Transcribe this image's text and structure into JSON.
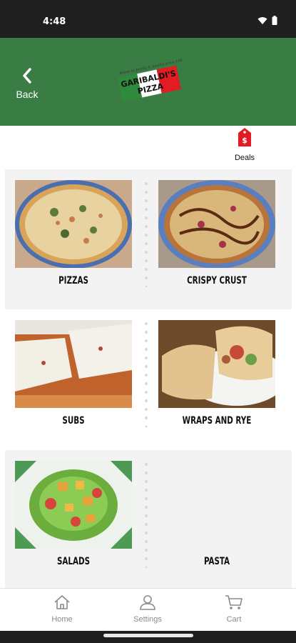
{
  "status_bar": {
    "time": "4:48",
    "icons": [
      "wifi-icon",
      "battery-icon"
    ]
  },
  "header": {
    "back_label": "Back",
    "logo": {
      "brand": "GARIBALDI'S PIZZA",
      "tagline": "Home to family & quality since 1987"
    },
    "background": "#3a7d44"
  },
  "deals": {
    "label": "Deals",
    "icon": "price-tag-icon",
    "color": "#e31b23"
  },
  "categories": [
    {
      "label": "PIZZAS"
    },
    {
      "label": "CRISPY CRUST"
    },
    {
      "label": "SUBS"
    },
    {
      "label": "WRAPS AND RYE"
    },
    {
      "label": "SALADS"
    },
    {
      "label": "PASTA"
    }
  ],
  "bottom_nav": {
    "items": [
      {
        "label": "Home",
        "icon": "home-icon"
      },
      {
        "label": "Settings",
        "icon": "user-icon"
      },
      {
        "label": "Cart",
        "icon": "cart-icon"
      }
    ]
  }
}
